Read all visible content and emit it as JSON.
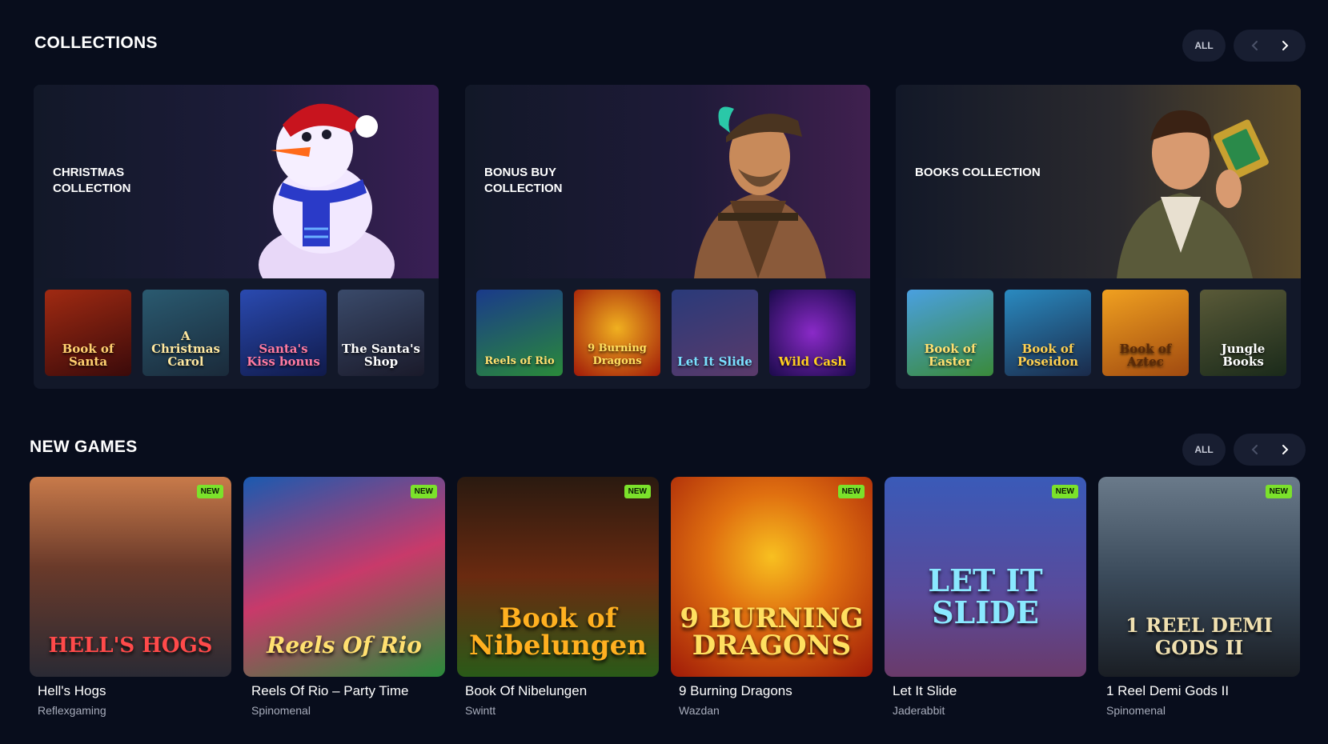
{
  "collections": {
    "title": "COLLECTIONS",
    "all_label": "ALL",
    "cards": [
      {
        "label": "CHRISTMAS COLLECTION",
        "art_icon": "snowman-icon",
        "thumbs": [
          {
            "title": "Book of Santa",
            "bg": "#7a1a12"
          },
          {
            "title": "A Christmas Carol",
            "bg": "#2a4a5e"
          },
          {
            "title": "Santa's Kiss bonus",
            "bg": "#1c3c8a"
          },
          {
            "title": "The Santa's Shop",
            "bg": "#2b2f4a"
          }
        ]
      },
      {
        "label": "BONUS BUY COLLECTION",
        "art_icon": "pirate-icon",
        "thumbs": [
          {
            "title": "Reels of Rio",
            "bg": "#1a5a2a"
          },
          {
            "title": "9 Burning Dragons",
            "bg": "#a0200a"
          },
          {
            "title": "Let It Slide",
            "bg": "#3a4a8a"
          },
          {
            "title": "Wild Cash",
            "bg": "#3a1a7a"
          }
        ]
      },
      {
        "label": "BOOKS COLLECTION",
        "art_icon": "explorer-icon",
        "thumbs": [
          {
            "title": "Book of Easter",
            "bg": "#3a8ac0"
          },
          {
            "title": "Book of Poseidon",
            "bg": "#1a6a8a"
          },
          {
            "title": "Book of Aztec",
            "bg": "#d08a1a"
          },
          {
            "title": "Jungle Books",
            "bg": "#3a3a28"
          }
        ]
      }
    ]
  },
  "new_games": {
    "title": "NEW GAMES",
    "all_label": "ALL",
    "badge": "NEW",
    "items": [
      {
        "name": "Hell's Hogs",
        "provider": "Reflexgaming",
        "art_text": "HELL'S HOGS",
        "bg1": "#8a5a3a",
        "bg2": "#2a2a34"
      },
      {
        "name": "Reels Of Rio – Party Time",
        "provider": "Spinomenal",
        "art_text": "Reels Of Rio",
        "bg1": "#1a6aa8",
        "bg2": "#2a7a3a"
      },
      {
        "name": "Book Of Nibelungen",
        "provider": "Swintt",
        "art_text": "Book of Nibelungen",
        "bg1": "#3a1a10",
        "bg2": "#2a5a18"
      },
      {
        "name": "9 Burning Dragons",
        "provider": "Wazdan",
        "art_text": "9 BURNING DRAGONS",
        "bg1": "#e0a010",
        "bg2": "#a01a08"
      },
      {
        "name": "Let It Slide",
        "provider": "Jaderabbit",
        "art_text": "LET IT SLIDE",
        "bg1": "#3a5ab8",
        "bg2": "#6a3a7a"
      },
      {
        "name": "1 Reel Demi Gods II",
        "provider": "Spinomenal",
        "art_text": "1 REEL DEMI GODS II",
        "bg1": "#4a5a6a",
        "bg2": "#1a1e24"
      }
    ]
  }
}
